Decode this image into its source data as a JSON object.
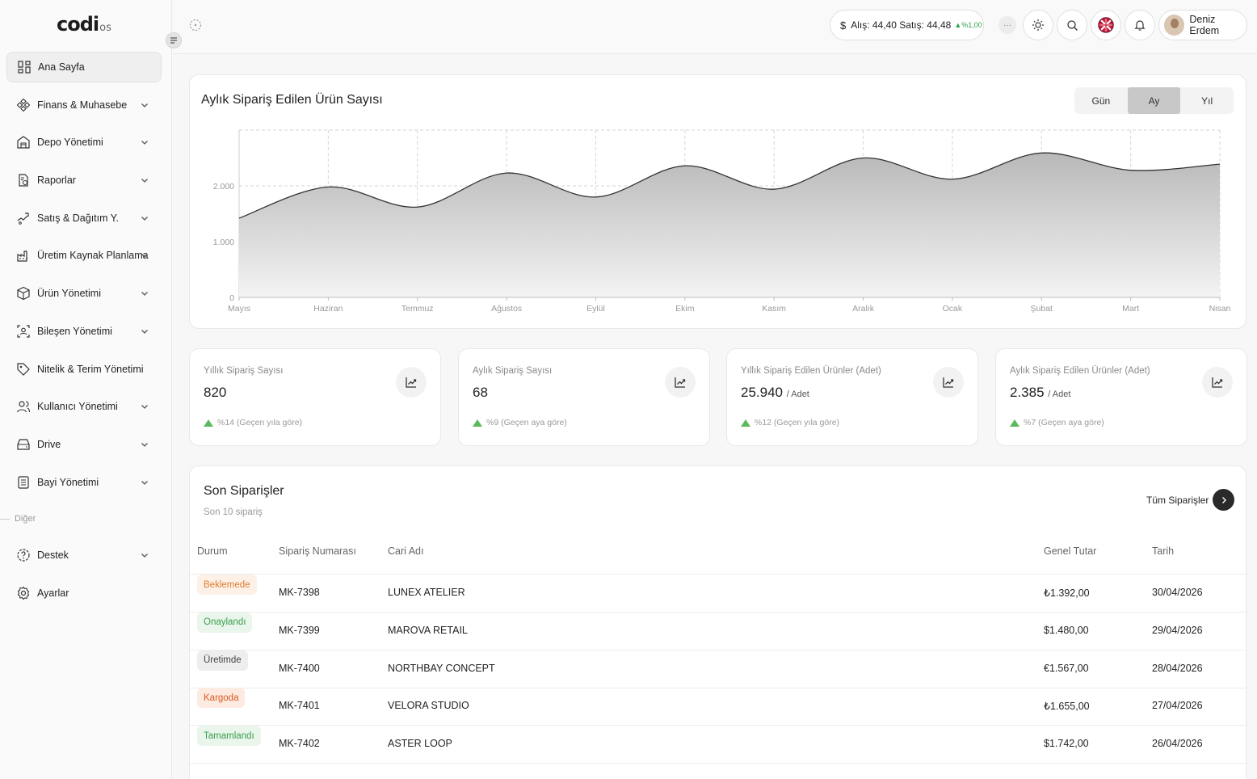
{
  "app": {
    "logo_text": "codi",
    "logo_sub": "os"
  },
  "sidebar": {
    "items": [
      {
        "label": "Ana Sayfa",
        "icon": "grid-icon",
        "active": true,
        "chevron": false
      },
      {
        "label": "Finans & Muhasebe",
        "icon": "finance-icon",
        "chevron": true
      },
      {
        "label": "Depo Yönetimi",
        "icon": "warehouse-icon",
        "chevron": true
      },
      {
        "label": "Raporlar",
        "icon": "report-icon",
        "chevron": true
      },
      {
        "label": "Satış & Dağıtım Y.",
        "icon": "sales-icon",
        "chevron": true
      },
      {
        "label": "Üretim Kaynak Planlama",
        "icon": "factory-icon",
        "chevron": true
      },
      {
        "label": "Ürün Yönetimi",
        "icon": "box-icon",
        "chevron": true
      },
      {
        "label": "Bileşen Yönetimi",
        "icon": "component-icon",
        "chevron": true
      },
      {
        "label": "Nitelik & Terim Yönetimi",
        "icon": "tag-icon",
        "chevron": false
      },
      {
        "label": "Kullanıcı Yönetimi",
        "icon": "users-icon",
        "chevron": true
      },
      {
        "label": "Drive",
        "icon": "drive-icon",
        "chevron": true
      },
      {
        "label": "Bayi Yönetimi",
        "icon": "dealer-icon",
        "chevron": true
      }
    ],
    "section_label": "Diğer",
    "items2": [
      {
        "label": "Destek",
        "icon": "support-icon",
        "chevron": true
      },
      {
        "label": "Ayarlar",
        "icon": "settings-icon",
        "chevron": false
      }
    ]
  },
  "header": {
    "currency_text": "Alış: 44,40 Satış: 44,48",
    "currency_change": "%1,00",
    "more_label": "···",
    "user_name": "Deniz Erdem"
  },
  "chart_card": {
    "title": "Aylık Sipariş Edilen Ürün Sayısı",
    "periods": [
      "Gün",
      "Ay",
      "Yıl"
    ],
    "active_period": "Ay"
  },
  "chart_data": {
    "type": "area",
    "categories": [
      "Mayıs",
      "Haziran",
      "Temmuz",
      "Ağustos",
      "Eylül",
      "Ekim",
      "Kasım",
      "Aralık",
      "Ocak",
      "Şubat",
      "Mart",
      "Nisan"
    ],
    "values": [
      1420,
      1980,
      1620,
      2230,
      1800,
      2360,
      1940,
      2500,
      2120,
      2590,
      2280,
      2390
    ],
    "yticks": [
      0,
      1000,
      2000
    ],
    "ytick_labels": [
      "0",
      "1.000",
      "2.000"
    ],
    "ylim": [
      0,
      3000
    ],
    "grid": true,
    "colors": {
      "line": "#333333",
      "fill_top": "#b8b8b8",
      "fill_bottom": "#f4f4f4"
    }
  },
  "stats": [
    {
      "label": "Yıllık Sipariş Sayısı",
      "value": "820",
      "unit": "",
      "trend": "%14 (Geçen yıla göre)"
    },
    {
      "label": "Aylık Sipariş Sayısı",
      "value": "68",
      "unit": "",
      "trend": "%9 (Geçen aya göre)"
    },
    {
      "label": "Yıllık Sipariş Edilen Ürünler (Adet)",
      "value": "25.940",
      "unit": "/ Adet",
      "trend": "%12 (Geçen yıla göre)"
    },
    {
      "label": "Aylık Sipariş Edilen Ürünler (Adet)",
      "value": "2.385",
      "unit": "/ Adet",
      "trend": "%7 (Geçen aya göre)"
    }
  ],
  "orders": {
    "title": "Son Siparişler",
    "subtitle": "Son 10 sipariş",
    "all_label": "Tüm Siparişler",
    "columns": [
      "Durum",
      "Sipariş Numarası",
      "Cari Adı",
      "Genel Tutar",
      "Tarih"
    ],
    "rows": [
      {
        "status": "Beklemede",
        "status_color": "#e07b2f",
        "status_bg": "#fdf0e6",
        "no": "MK-7398",
        "customer": "LUNEX ATELIER",
        "total": "₺1.392,00",
        "date": "30/04/2026"
      },
      {
        "status": "Onaylandı",
        "status_color": "#3a9d4a",
        "status_bg": "#eaf6ec",
        "no": "MK-7399",
        "customer": "MAROVA RETAIL",
        "total": "$1.480,00",
        "date": "29/04/2026"
      },
      {
        "status": "Üretimde",
        "status_color": "#444444",
        "status_bg": "#eeeeee",
        "no": "MK-7400",
        "customer": "NORTHBAY CONCEPT",
        "total": "€1.567,00",
        "date": "28/04/2026"
      },
      {
        "status": "Kargoda",
        "status_color": "#d95a1e",
        "status_bg": "#fdebe2",
        "no": "MK-7401",
        "customer": "VELORA STUDIO",
        "total": "₺1.655,00",
        "date": "27/04/2026"
      },
      {
        "status": "Tamamlandı",
        "status_color": "#3a9d4a",
        "status_bg": "#eaf6ec",
        "no": "MK-7402",
        "customer": "ASTER LOOP",
        "total": "$1.742,00",
        "date": "26/04/2026"
      }
    ]
  }
}
